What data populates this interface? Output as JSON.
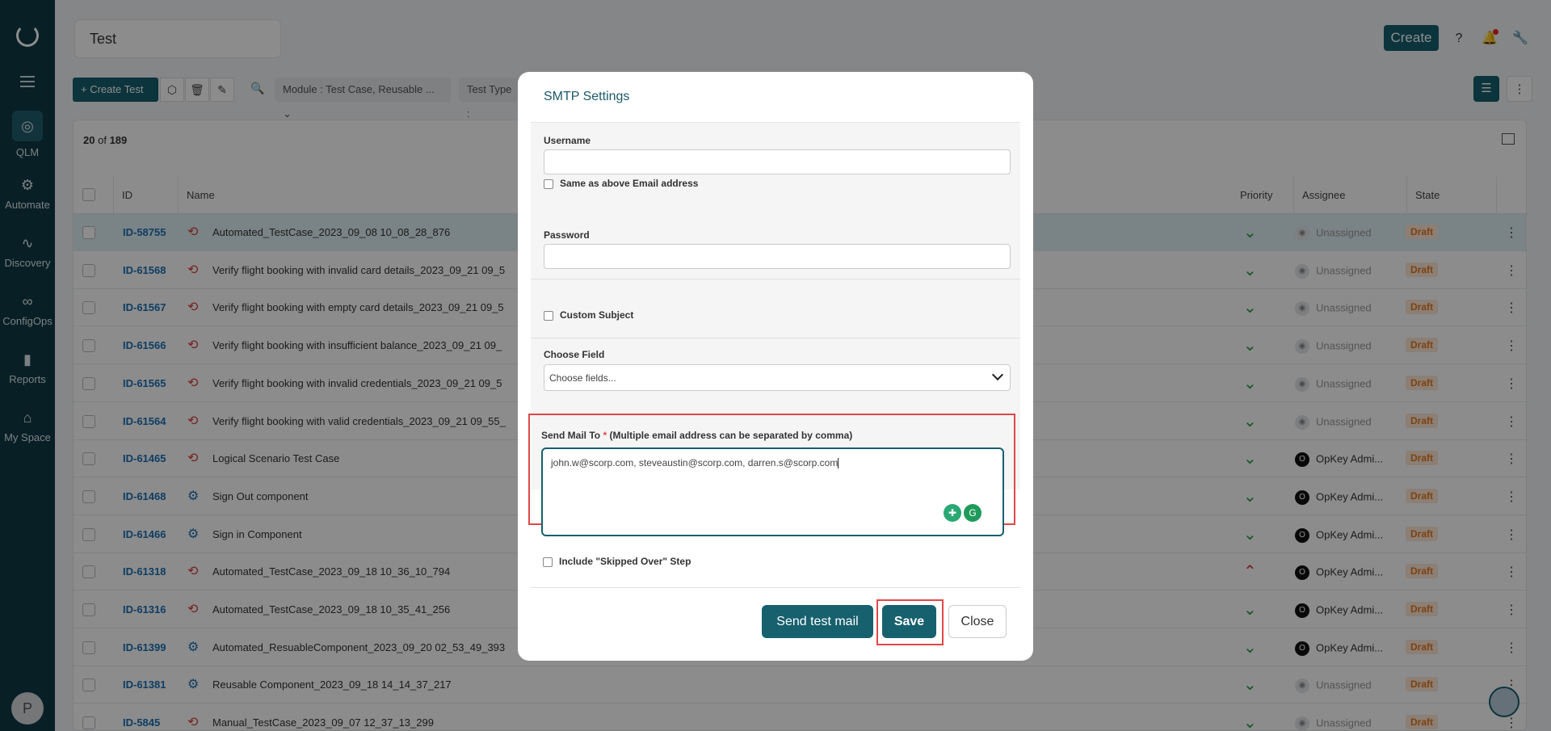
{
  "sidebar": {
    "items": [
      {
        "label": "QLM",
        "icon": "target-icon"
      },
      {
        "label": "Automate",
        "icon": "gears-icon"
      },
      {
        "label": "Discovery",
        "icon": "pulse-icon"
      },
      {
        "label": "ConfigOps",
        "icon": "infinity-icon"
      },
      {
        "label": "Reports",
        "icon": "bar-chart-icon"
      },
      {
        "label": "My Space",
        "icon": "home-icon"
      }
    ],
    "avatar_initial": "P"
  },
  "header": {
    "page_title": "Test",
    "create_label": "Create"
  },
  "toolbar": {
    "create_test_label": "Create Test",
    "filter_module": "Module :  Test Case, Reusable ...",
    "filter_type": "Test Type :"
  },
  "table": {
    "count_shown": "20",
    "count_of": "of",
    "count_total": "189",
    "columns": [
      "ID",
      "Name",
      "Priority",
      "Assignee",
      "State"
    ],
    "rows": [
      {
        "id": "ID-58755",
        "name": "Automated_TestCase_2023_09_08 10_08_28_876",
        "assignee": "Unassigned",
        "state": "Draft",
        "kind": "case",
        "prio": "down",
        "op": false
      },
      {
        "id": "ID-61568",
        "name": "Verify flight booking with invalid card details_2023_09_21 09_5",
        "assignee": "Unassigned",
        "state": "Draft",
        "kind": "case",
        "prio": "down",
        "op": false
      },
      {
        "id": "ID-61567",
        "name": "Verify flight booking with empty card details_2023_09_21 09_5",
        "assignee": "Unassigned",
        "state": "Draft",
        "kind": "case",
        "prio": "down",
        "op": false
      },
      {
        "id": "ID-61566",
        "name": "Verify flight booking with insufficient balance_2023_09_21 09_",
        "assignee": "Unassigned",
        "state": "Draft",
        "kind": "case",
        "prio": "down",
        "op": false
      },
      {
        "id": "ID-61565",
        "name": "Verify flight booking with invalid credentials_2023_09_21 09_5",
        "assignee": "Unassigned",
        "state": "Draft",
        "kind": "case",
        "prio": "down",
        "op": false
      },
      {
        "id": "ID-61564",
        "name": "Verify flight booking with valid credentials_2023_09_21 09_55_",
        "assignee": "Unassigned",
        "state": "Draft",
        "kind": "case",
        "prio": "down",
        "op": false
      },
      {
        "id": "ID-61465",
        "name": "Logical Scenario Test Case",
        "assignee": "OpKey Admi...",
        "state": "Draft",
        "kind": "case",
        "prio": "down",
        "op": true
      },
      {
        "id": "ID-61468",
        "name": "Sign Out component",
        "assignee": "OpKey Admi...",
        "state": "Draft",
        "kind": "comp",
        "prio": "down",
        "op": true
      },
      {
        "id": "ID-61466",
        "name": "Sign in Component",
        "assignee": "OpKey Admi...",
        "state": "Draft",
        "kind": "comp",
        "prio": "down",
        "op": true
      },
      {
        "id": "ID-61318",
        "name": "Automated_TestCase_2023_09_18 10_36_10_794",
        "assignee": "OpKey Admi...",
        "state": "Draft",
        "kind": "case",
        "prio": "up",
        "op": true
      },
      {
        "id": "ID-61316",
        "name": "Automated_TestCase_2023_09_18 10_35_41_256",
        "assignee": "OpKey Admi...",
        "state": "Draft",
        "kind": "case",
        "prio": "down",
        "op": true
      },
      {
        "id": "ID-61399",
        "name": "Automated_ResuableComponent_2023_09_20 02_53_49_393",
        "assignee": "OpKey Admi...",
        "state": "Draft",
        "kind": "comp",
        "prio": "down",
        "op": true
      },
      {
        "id": "ID-61381",
        "name": "Reusable Component_2023_09_18 14_14_37_217",
        "assignee": "Unassigned",
        "state": "Draft",
        "kind": "comp",
        "prio": "down",
        "op": false
      },
      {
        "id": "ID-5845",
        "name": "Manual_TestCase_2023_09_07 12_37_13_299",
        "assignee": "Unassigned",
        "state": "Draft",
        "kind": "case",
        "prio": "down",
        "op": false
      }
    ]
  },
  "modal": {
    "title": "SMTP Settings",
    "username_label": "Username",
    "username_value": "",
    "same_as_above_label": "Same as above Email address",
    "password_label": "Password",
    "password_value": "",
    "custom_subject_label": "Custom Subject",
    "choose_field_label": "Choose Field",
    "choose_field_placeholder": "Choose fields...",
    "send_to_label": "Send Mail To",
    "send_to_required": "*",
    "send_to_hint": "(Multiple email address can be separated by comma)",
    "send_to_value": "john.w@scorp.com, steveaustin@scorp.com, darren.s@scorp.com",
    "skipped_label": "Include \"Skipped Over\" Step",
    "send_test_label": "Send test mail",
    "save_label": "Save",
    "close_label": "Close"
  },
  "colors": {
    "brand": "#17606e",
    "sidebar": "#0f3a45",
    "highlight_frame": "#e04848",
    "draft_text": "#e8791d"
  }
}
